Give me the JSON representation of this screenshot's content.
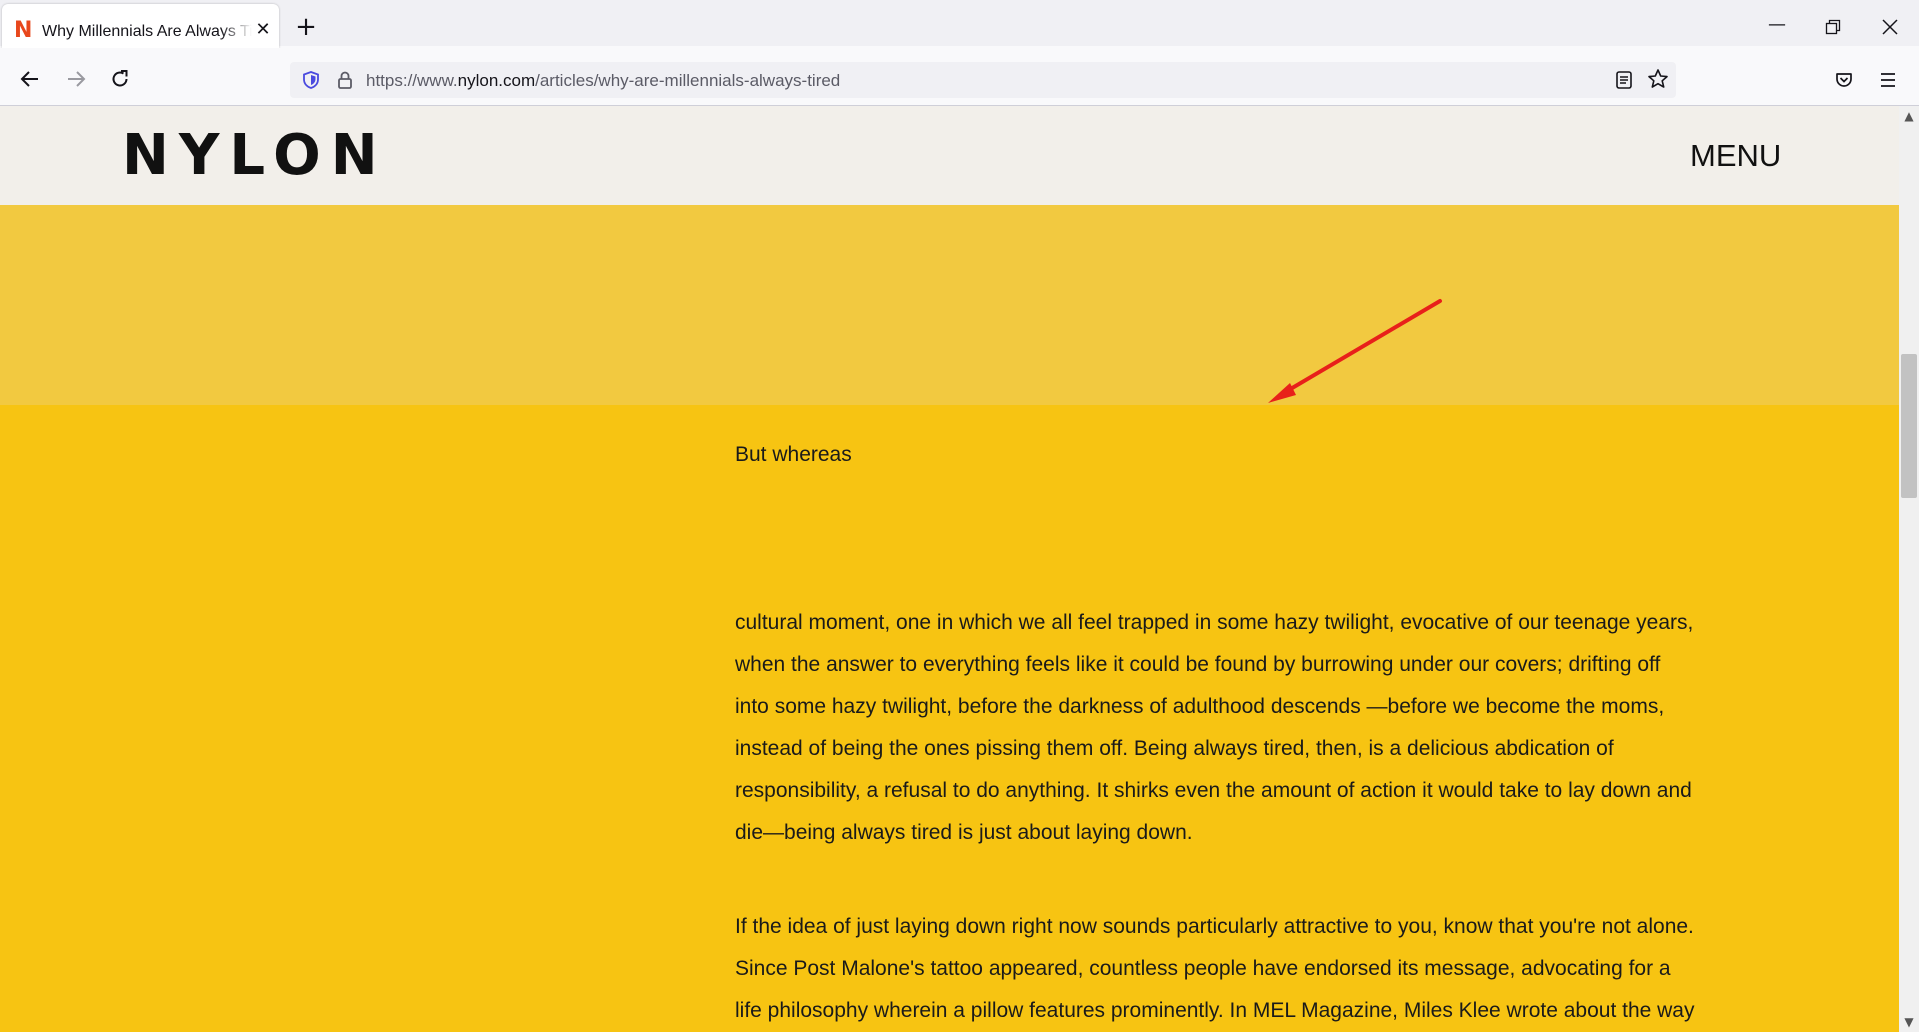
{
  "browser": {
    "tab_title": "Why Millennials Are Always Tired",
    "tab_favicon": "N",
    "close_tab_glyph": "✕",
    "new_tab_glyph": "+",
    "url_prefix": "https://www.",
    "url_host": "nylon.com",
    "url_path": "/articles/why-are-millennials-always-tired",
    "icons": {
      "back": "back-arrow-icon",
      "forward": "forward-arrow-icon",
      "reload": "reload-icon",
      "shield": "tracking-protection-shield-icon",
      "lock": "lock-icon",
      "reader": "reader-view-icon",
      "bookmark": "bookmark-star-icon",
      "pocket": "pocket-icon",
      "menu": "hamburger-menu-icon",
      "minimize": "minimize-icon",
      "restore": "restore-icon",
      "close": "close-window-icon"
    }
  },
  "site": {
    "logo": "NYLON",
    "menu_label": "MENU"
  },
  "article": {
    "short_text": "But whereas",
    "paragraph_1": "cultural moment, one in which we all feel trapped in some hazy twilight, evocative of our teenage years, when the answer to everything feels like it could be found by burrowing under our covers; drifting off into some hazy twilight, before the darkness of adulthood descends —before we become the moms, instead of being the ones pissing them off. Being always tired, then, is a delicious abdication of responsibility, a refusal to do anything. It shirks even the amount of action it would take to lay down and die—being always tired is just about laying down.",
    "paragraph_2": "If the idea of just laying down right now sounds particularly attractive to you, know that you're not alone. Since Post Malone's tattoo appeared, countless people have endorsed its message, advocating for a life philosophy wherein a pillow features prominently. In MEL Magazine, Miles Klee wrote about the way in which the Always Tired tattoo \"embodies the millennial cult of"
  },
  "colors": {
    "header_bg": "#f2efea",
    "light_band": "#f2c940",
    "page_bg": "#f7c412",
    "annotation_arrow": "#e8201a"
  }
}
